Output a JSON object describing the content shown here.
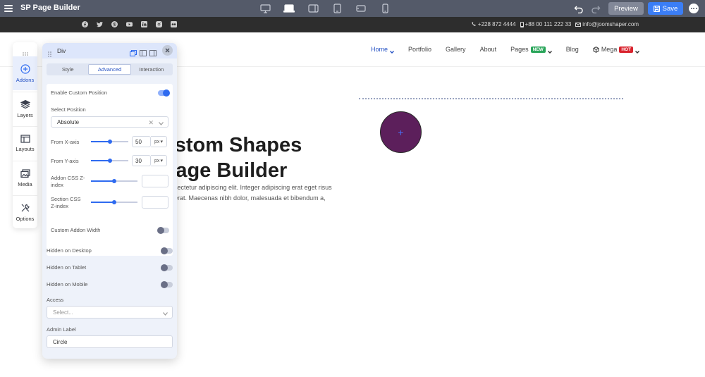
{
  "app": {
    "title": "SP Page Builder"
  },
  "toolbar": {
    "devices": [
      "desktop-monitor",
      "laptop",
      "tablet-landscape",
      "tablet-portrait",
      "mobile-landscape",
      "mobile-portrait"
    ],
    "active_device": "laptop",
    "preview_label": "Preview",
    "save_label": "Save"
  },
  "site_top": {
    "socials": [
      "facebook-icon",
      "twitter-icon",
      "pinterest-icon",
      "youtube-icon",
      "linkedin-icon",
      "instagram-icon",
      "flickr-icon"
    ],
    "phone1": "+228 872 4444",
    "phone2": "+88 00 111 222 33",
    "email": "info@joomshaper.com"
  },
  "nav": {
    "items": [
      {
        "label": "Home",
        "active": true,
        "dropdown": true
      },
      {
        "label": "Portfolio"
      },
      {
        "label": "Gallery"
      },
      {
        "label": "About"
      },
      {
        "label": "Pages",
        "badge": "NEW",
        "dropdown": true
      },
      {
        "label": "Blog"
      },
      {
        "label": "Mega",
        "badge": "HOT",
        "dropdown": true
      }
    ]
  },
  "canvas": {
    "heading_line1": "ustom Shapes",
    "heading_line2": "Page Builder",
    "para_line1": "sectetur adipiscing elit. Integer adipiscing erat eget risus",
    "para_line2": "erat. Maecenas nibh dolor, malesuada et bibendum a,",
    "circle_plus": "+",
    "circle_color": "#5c1f5b"
  },
  "left_bar": {
    "items": [
      {
        "label": "Addons",
        "icon": "plus-circle-icon",
        "active": true
      },
      {
        "label": "Layers",
        "icon": "layers-icon"
      },
      {
        "label": "Layouts",
        "icon": "layouts-icon"
      },
      {
        "label": "Media",
        "icon": "media-icon"
      },
      {
        "label": "Options",
        "icon": "tools-icon"
      }
    ]
  },
  "panel": {
    "title": "Div",
    "tabs": [
      "Style",
      "Advanced",
      "Interaction"
    ],
    "active_tab": "Advanced",
    "enable_custom_position": {
      "label": "Enable Custom Position",
      "on": true
    },
    "select_position": {
      "label": "Select Position",
      "value": "Absolute"
    },
    "from_x": {
      "label": "From X-axis",
      "value": "50",
      "unit": "px"
    },
    "from_y": {
      "label": "From Y-axis",
      "value": "30",
      "unit": "px"
    },
    "addon_z": {
      "label_line1": "Addon CSS Z-",
      "label_line2": "index",
      "value": ""
    },
    "section_z": {
      "label_line1": "Section CSS",
      "label_line2": "Z-index",
      "value": ""
    },
    "custom_addon_width": {
      "label": "Custom Addon Width",
      "on": false
    },
    "hidden_desktop": {
      "label": "Hidden on Desktop",
      "on": false
    },
    "hidden_tablet": {
      "label": "Hidden on Tablet",
      "on": false
    },
    "hidden_mobile": {
      "label": "Hidden on Mobile",
      "on": false
    },
    "access": {
      "label": "Access",
      "placeholder": "Select..."
    },
    "admin_label": {
      "label": "Admin Label",
      "value": "Circle"
    }
  },
  "colors": {
    "accent": "#2f6bf0",
    "topbar": "#545a69",
    "save": "#3b7ef6",
    "badge_new": "#2aa55a",
    "badge_hot": "#d9232d"
  }
}
